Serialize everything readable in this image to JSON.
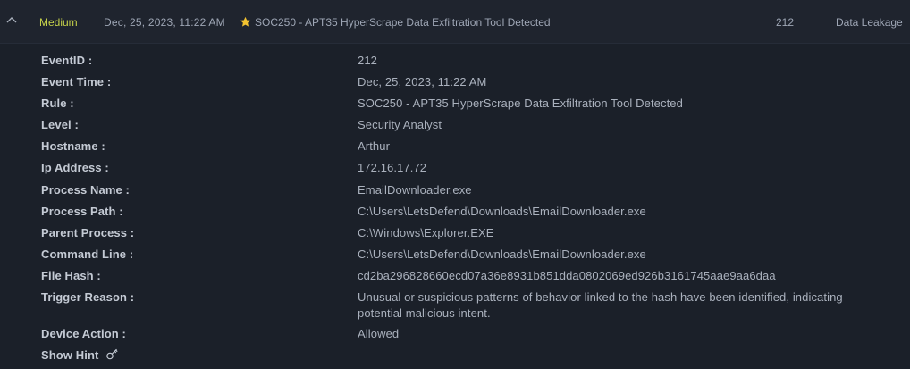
{
  "alert_row": {
    "severity": "Medium",
    "date": "Dec, 25, 2023, 11:22 AM",
    "rule": "SOC250 - APT35 HyperScrape Data Exfiltration Tool Detected",
    "event_id": "212",
    "type": "Data Leakage",
    "colors": {
      "severity": "#c6d24a",
      "star": "#f2c230"
    },
    "icons": {
      "collapse": "chevron-up-icon",
      "favorite": "star-icon"
    }
  },
  "details": {
    "event_id": {
      "label": "EventID :",
      "value": "212"
    },
    "event_time": {
      "label": "Event Time :",
      "value": "Dec, 25, 2023, 11:22 AM"
    },
    "rule": {
      "label": "Rule :",
      "value": "SOC250 - APT35 HyperScrape Data Exfiltration Tool Detected"
    },
    "level": {
      "label": "Level :",
      "value": "Security Analyst"
    },
    "hostname": {
      "label": "Hostname :",
      "value": "Arthur"
    },
    "ip_address": {
      "label": "Ip Address :",
      "value": "172.16.17.72"
    },
    "process_name": {
      "label": "Process Name :",
      "value": "EmailDownloader.exe"
    },
    "process_path": {
      "label": "Process Path :",
      "value": "C:\\Users\\LetsDefend\\Downloads\\EmailDownloader.exe"
    },
    "parent_process": {
      "label": "Parent Process :",
      "value": "C:\\Windows\\Explorer.EXE"
    },
    "command_line": {
      "label": "Command Line :",
      "value": "C:\\Users\\LetsDefend\\Downloads\\EmailDownloader.exe"
    },
    "file_hash": {
      "label": "File Hash :",
      "value": "cd2ba296828660ecd07a36e8931b851dda0802069ed926b3161745aae9aa6daa"
    },
    "trigger_reason": {
      "label": "Trigger Reason :",
      "value_line1": "Unusual or suspicious patterns of behavior linked to the hash have been identified, indicating",
      "value_line2": "potential malicious intent."
    },
    "device_action": {
      "label": "Device Action :",
      "value": "Allowed"
    },
    "show_hint": {
      "label": "Show Hint",
      "icon": "key-icon"
    }
  }
}
